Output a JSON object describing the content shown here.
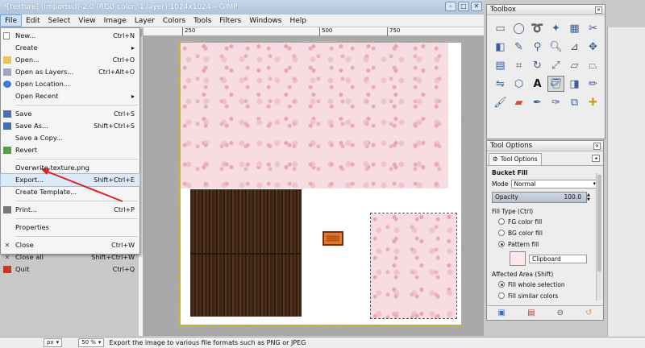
{
  "window": {
    "title": "*[texture] (imported)-2.0 (RGB color, 1 layer) 1024x1024 – GIMP"
  },
  "menubar": [
    {
      "label": "File"
    },
    {
      "label": "Edit"
    },
    {
      "label": "Select"
    },
    {
      "label": "View"
    },
    {
      "label": "Image"
    },
    {
      "label": "Layer"
    },
    {
      "label": "Colors"
    },
    {
      "label": "Tools"
    },
    {
      "label": "Filters"
    },
    {
      "label": "Windows"
    },
    {
      "label": "Help"
    }
  ],
  "ruler": {
    "marks": [
      "250",
      "500",
      "750"
    ]
  },
  "file_menu": {
    "items": [
      {
        "label": "New...",
        "shortcut": "Ctrl+N",
        "icon": "new-icon"
      },
      {
        "label": "Create",
        "shortcut": "▸",
        "icon": ""
      },
      {
        "label": "Open...",
        "shortcut": "Ctrl+O",
        "icon": "open-icon"
      },
      {
        "label": "Open as Layers...",
        "shortcut": "Ctrl+Alt+O",
        "icon": "open-layers-icon"
      },
      {
        "label": "Open Location...",
        "shortcut": "",
        "icon": "globe-icon"
      },
      {
        "label": "Open Recent",
        "shortcut": "▸",
        "icon": ""
      },
      {
        "label": "Save",
        "shortcut": "Ctrl+S",
        "icon": "save-icon"
      },
      {
        "label": "Save As...",
        "shortcut": "Shift+Ctrl+S",
        "icon": "save-as-icon"
      },
      {
        "label": "Save a Copy...",
        "shortcut": "",
        "icon": ""
      },
      {
        "label": "Revert",
        "shortcut": "",
        "icon": "revert-icon"
      },
      {
        "label": "Overwrite texture.png",
        "shortcut": "",
        "icon": ""
      },
      {
        "label": "Export...",
        "shortcut": "Shift+Ctrl+E",
        "icon": ""
      },
      {
        "label": "Create Template...",
        "shortcut": "",
        "icon": ""
      },
      {
        "label": "Print...",
        "shortcut": "Ctrl+P",
        "icon": "print-icon"
      },
      {
        "label": "Properties",
        "shortcut": "",
        "icon": ""
      },
      {
        "label": "Close",
        "shortcut": "Ctrl+W",
        "icon": "close-icon"
      },
      {
        "label": "Close all",
        "shortcut": "Shift+Ctrl+W",
        "icon": "close-all-icon"
      },
      {
        "label": "Quit",
        "shortcut": "Ctrl+Q",
        "icon": "quit-icon"
      }
    ]
  },
  "status": {
    "unit": "px",
    "zoom": "50 %",
    "message": "Export the image to various file formats such as PNG or JPEG"
  },
  "toolbox": {
    "title": "Toolbox"
  },
  "tool_options": {
    "title": "Tool Options",
    "tab_label": "Tool Options",
    "tool_name": "Bucket Fill",
    "mode_label": "Mode",
    "mode_value": "Normal",
    "opacity_label": "Opacity",
    "opacity_value": "100.0",
    "fill_type_label": "Fill Type  (Ctrl)",
    "fill_fg": "FG color fill",
    "fill_bg": "BG color fill",
    "fill_pattern": "Pattern fill",
    "pattern_name": "Clipboard",
    "affected_label": "Affected Area  (Shift)",
    "area_whole": "Fill whole selection",
    "area_similar": "Fill similar colors"
  },
  "colors": {
    "accent": "#d9242b",
    "highlight": "#dceaf8"
  }
}
